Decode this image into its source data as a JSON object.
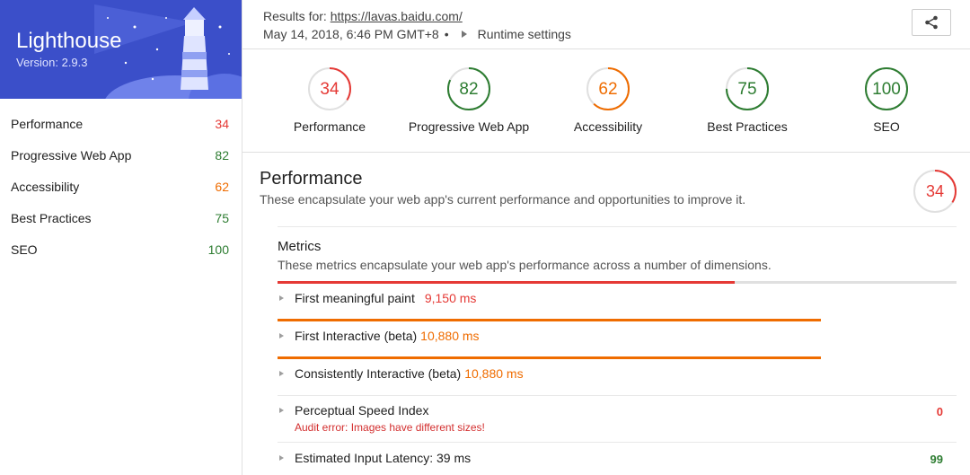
{
  "app": {
    "title": "Lighthouse",
    "version": "Version: 2.9.3"
  },
  "colors": {
    "red": "#e53935",
    "orange": "#ef6c00",
    "green": "#2e7d32",
    "brand": "#3b4fc9"
  },
  "sidebar": {
    "items": [
      {
        "label": "Performance",
        "score": "34",
        "color": "#e53935"
      },
      {
        "label": "Progressive Web App",
        "score": "82",
        "color": "#2e7d32"
      },
      {
        "label": "Accessibility",
        "score": "62",
        "color": "#ef6c00"
      },
      {
        "label": "Best Practices",
        "score": "75",
        "color": "#2e7d32"
      },
      {
        "label": "SEO",
        "score": "100",
        "color": "#2e7d32"
      }
    ]
  },
  "header": {
    "results_prefix": "Results for: ",
    "url": "https://lavas.baidu.com/",
    "timestamp": "May 14, 2018, 6:46 PM GMT+8",
    "separator": "•",
    "runtime_settings": "Runtime settings",
    "share_icon": "share-icon"
  },
  "gauges": [
    {
      "label": "Performance",
      "score": 34,
      "display": "34",
      "color": "#e53935"
    },
    {
      "label": "Progressive Web App",
      "score": 82,
      "display": "82",
      "color": "#2e7d32"
    },
    {
      "label": "Accessibility",
      "score": 62,
      "display": "62",
      "color": "#ef6c00"
    },
    {
      "label": "Best Practices",
      "score": 75,
      "display": "75",
      "color": "#2e7d32"
    },
    {
      "label": "SEO",
      "score": 100,
      "display": "100",
      "color": "#2e7d32"
    }
  ],
  "performance": {
    "title": "Performance",
    "description": "These encapsulate your web app's current performance and opportunities to improve it.",
    "score": 34,
    "score_display": "34"
  },
  "metrics": {
    "title": "Metrics",
    "description": "These metrics encapsulate your web app's performance across a number of dimensions.",
    "items": [
      {
        "label": "First meaningful paint",
        "value": "9,150 ms",
        "bar_color": "#e53935",
        "bar_fraction": 0.673
      },
      {
        "label": "First Interactive (beta)",
        "value": "10,880 ms",
        "bar_color": "#ef6c00",
        "bar_fraction": 0.8
      },
      {
        "label": "Consistently Interactive (beta)",
        "value": "10,880 ms",
        "bar_color": "#ef6c00",
        "bar_fraction": 0.8
      }
    ],
    "perceptual": {
      "label": "Perceptual Speed Index",
      "error": "Audit error: Images have different sizes!",
      "score": "0"
    },
    "latency": {
      "label": "Estimated Input Latency: 39 ms",
      "score": "99"
    }
  }
}
